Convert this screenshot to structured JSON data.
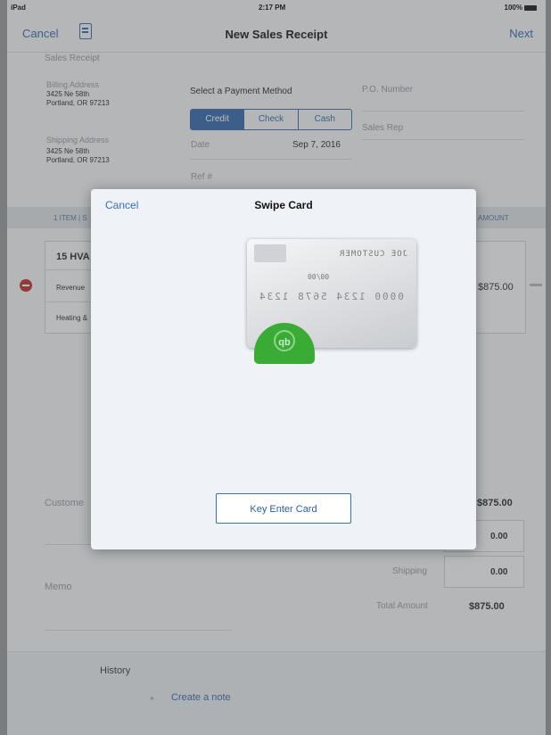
{
  "status_bar": {
    "carrier": "iPad",
    "time": "2:17 PM",
    "battery": "100%"
  },
  "nav": {
    "cancel": "Cancel",
    "title": "New Sales Receipt",
    "next": "Next"
  },
  "background_form": {
    "section_title": "Sales Receipt",
    "billing_label": "Billing Address",
    "billing_line1": "3425 Ne 58th",
    "billing_line2": "Portland, OR 97213",
    "shipping_label": "Shipping Address",
    "shipping_line1": "3425 Ne 58th",
    "shipping_line2": "Portland, OR 97213",
    "payment_heading": "Select a Payment Method",
    "payment_methods": [
      "Credit",
      "Check",
      "Cash"
    ],
    "date_label": "Date",
    "date_value": "Sep 7, 2016",
    "ref_label": "Ref #",
    "po_label": "P.O. Number",
    "sales_rep_label": "Sales Rep",
    "items_header": "1 ITEM | S",
    "amount_header": "AMOUNT",
    "item_name": "15 HVA",
    "item_account": "Revenue",
    "item_desc": "Heating &",
    "item_amount": "$875.00",
    "customer_label": "Custome",
    "subtotal": "$875.00",
    "discount": "0.00",
    "shipping_label2": "Shipping",
    "shipping_value": "0.00",
    "memo_label": "Memo",
    "total_label": "Total Amount",
    "total_value": "$875.00"
  },
  "footer": {
    "history_label": "History",
    "note_label": "Create a note"
  },
  "modal": {
    "cancel": "Cancel",
    "title": "Swipe Card",
    "card_name": "JOE CUSTOMER",
    "card_expiry": "00/00",
    "card_number": "0000 1234 5678 1234",
    "reader_logo": "qb",
    "key_enter_button": "Key Enter Card"
  }
}
